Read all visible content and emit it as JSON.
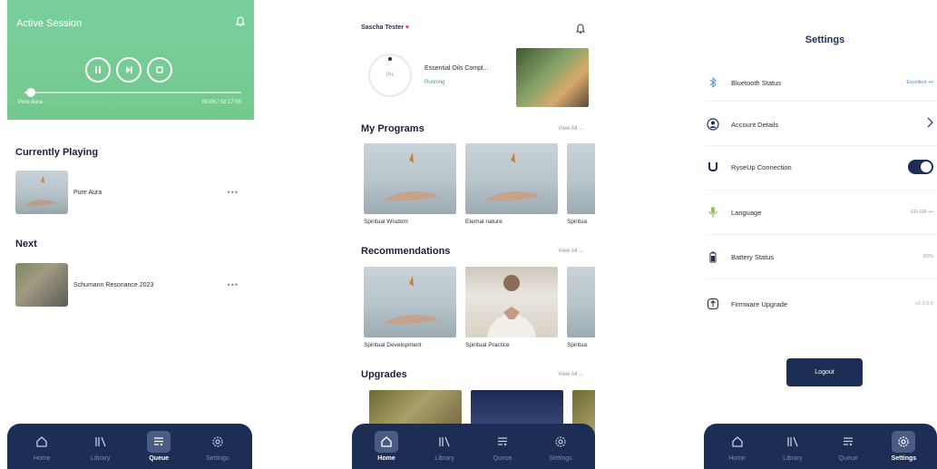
{
  "nav": {
    "home": "Home",
    "library": "Library",
    "queue": "Queue",
    "settings": "Settings"
  },
  "queue_screen": {
    "active_session_title": "Active Session",
    "player": {
      "track": "Pure Aura",
      "time": "00:06 / 02:17:00",
      "progress": 0.03
    },
    "currently_playing_title": "Currently Playing",
    "currently_playing": {
      "name": "Pure Aura",
      "more": "•••"
    },
    "next_title": "Next",
    "next": {
      "name": "Schumann Resonance 2023",
      "more": "•••"
    }
  },
  "home_screen": {
    "user_name": "Sascha Tester",
    "session": {
      "percent": "0%",
      "name": "Essential Oils Compl...",
      "status": "Running"
    },
    "my_programs": {
      "title": "My Programs",
      "view_all": "View All →",
      "items": [
        "Spiritual Wisdom",
        "Eternal nature",
        "Spiritua"
      ]
    },
    "recommendations": {
      "title": "Recommendations",
      "view_all": "View All →",
      "items": [
        "Spiritual Development",
        "Spiritual Practice",
        "Spiritua"
      ]
    },
    "upgrades": {
      "title": "Upgrades",
      "view_all": "View All →"
    }
  },
  "settings_screen": {
    "title": "Settings",
    "rows": {
      "bluetooth": {
        "label": "Bluetooth Status",
        "value": "Excellent •••"
      },
      "account": {
        "label": "Account Details"
      },
      "ryseup": {
        "label": "RyseUp Connection"
      },
      "language": {
        "label": "Language",
        "value": "EN-GB •••"
      },
      "battery": {
        "label": "Battery Status",
        "value": "83%"
      },
      "firmware": {
        "label": "Firmware Upgrade",
        "value": "v1.0.0.0"
      }
    },
    "logout": "Logout"
  },
  "colors": {
    "navy": "#1c2e56",
    "green": "#79cf9c",
    "running": "#3aa56a"
  }
}
